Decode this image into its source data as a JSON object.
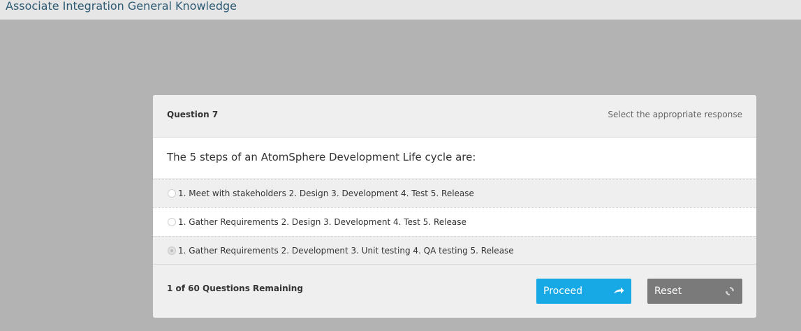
{
  "app": {
    "title": "Associate Integration General Knowledge"
  },
  "question": {
    "number_label": "Question 7",
    "instruction": "Select the appropriate response",
    "text": "The 5 steps of an AtomSphere Development Life cycle are:"
  },
  "answers": [
    {
      "label": "1. Meet with stakeholders 2. Design 3. Development 4. Test 5. Release",
      "selected": false
    },
    {
      "label": "1. Gather Requirements 2. Design 3. Development 4. Test 5. Release",
      "selected": false
    },
    {
      "label": "1. Gather Requirements 2. Development 3. Unit testing 4. QA testing 5. Release",
      "selected": true
    }
  ],
  "footer": {
    "remaining": "1 of 60 Questions Remaining",
    "proceed_label": "Proceed",
    "reset_label": "Reset"
  },
  "icons": {
    "proceed": "arrow-right-icon",
    "reset": "refresh-icon"
  },
  "colors": {
    "proceed_button": "#16a9e6",
    "reset_button": "#7a7a7a",
    "title": "#2c5a73"
  }
}
